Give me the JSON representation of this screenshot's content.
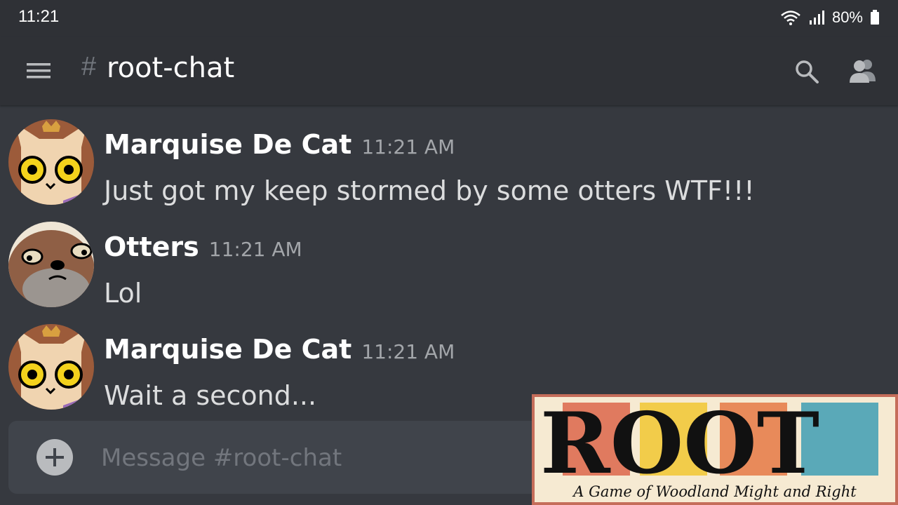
{
  "status_bar": {
    "time": "11:21",
    "battery": "80%",
    "icons": [
      "wifi-icon",
      "signal-icon",
      "battery-icon"
    ]
  },
  "header": {
    "hash": "#",
    "channel": "root-chat",
    "icons": [
      "menu-icon",
      "search-icon",
      "members-icon"
    ]
  },
  "messages": [
    {
      "author": "Marquise De Cat",
      "time": "11:21 AM",
      "text": "Just got my keep stormed by some otters WTF!!!"
    },
    {
      "author": "Otters",
      "time": "11:21 AM",
      "text": "Lol"
    },
    {
      "author": "Marquise De Cat",
      "time": "11:21 AM",
      "text": "Wait a second..."
    }
  ],
  "composer": {
    "placeholder": "Message #root-chat"
  },
  "logo": {
    "title": "ROOT",
    "tagline": "A Game of Woodland Might and Right"
  },
  "colors": {
    "background": "#36393f",
    "header": "#2f3136",
    "input": "#40444b",
    "author": "#ffffff",
    "timestamp": "#a3a6aa"
  }
}
